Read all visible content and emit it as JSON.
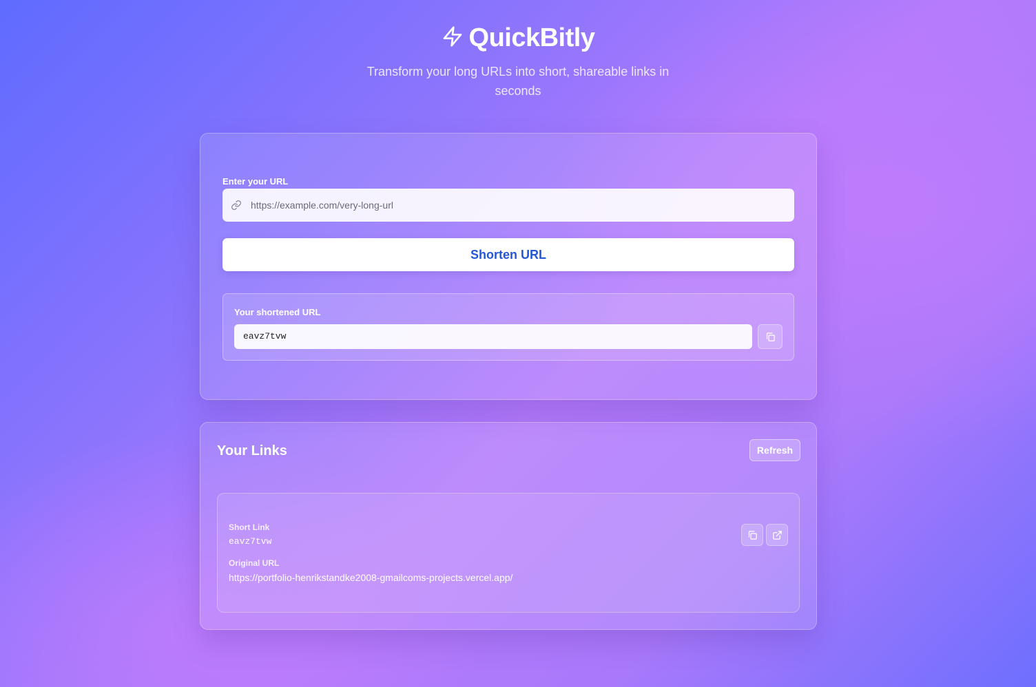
{
  "header": {
    "title": "QuickBitly",
    "subtitle": "Transform your long URLs into short, shareable links in seconds",
    "logo_icon": "lightning-bolt-icon"
  },
  "shorten_form": {
    "url_label": "Enter your URL",
    "url_placeholder": "https://example.com/very-long-url",
    "url_value": "",
    "link_icon": "link-icon",
    "submit_label": "Shorten URL"
  },
  "result": {
    "label": "Your shortened URL",
    "value": "eavz7tvw",
    "copy_icon": "copy-icon"
  },
  "links": {
    "title": "Your Links",
    "refresh_label": "Refresh",
    "items": [
      {
        "short_label": "Short Link",
        "short_value": "eavz7tvw",
        "original_label": "Original URL",
        "original_value": "https://portfolio-henrikstandke2008-gmailcoms-projects.vercel.app/"
      }
    ]
  },
  "colors": {
    "gradient_start": "#5f6bff",
    "gradient_mid": "#c07cfc",
    "button_text": "#2457d6"
  }
}
